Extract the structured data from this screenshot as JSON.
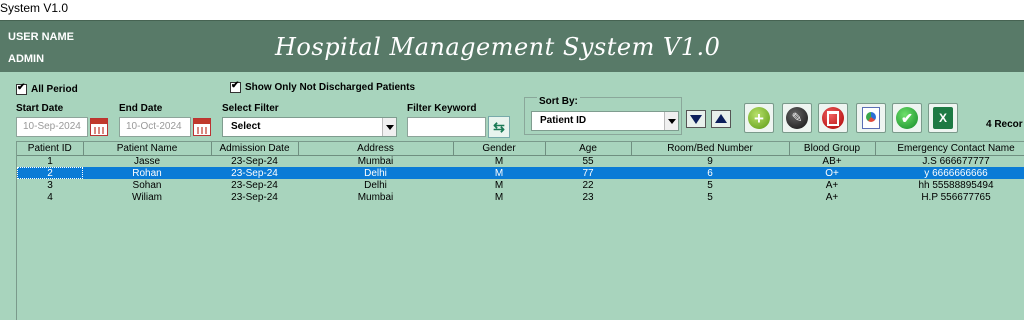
{
  "window": {
    "title": "System V1.0"
  },
  "header": {
    "user_label": "USER NAME",
    "user_value": "ADMIN",
    "app_title": "Hospital Management System V1.0",
    "bg_color": "#587a68"
  },
  "filters": {
    "all_period_label": "All Period",
    "all_period_checked": true,
    "discharged_label": "Show Only Not Discharged Patients",
    "discharged_checked": true,
    "start_date_label": "Start Date",
    "start_date_value": "10-Sep-2024",
    "end_date_label": "End Date",
    "end_date_value": "10-Oct-2024",
    "select_filter_label": "Select Filter",
    "select_filter_value": "Select",
    "keyword_label": "Filter Keyword",
    "keyword_value": ""
  },
  "sort": {
    "label": "Sort By:",
    "value": "Patient ID"
  },
  "toolbar": {
    "icons": [
      "add-icon",
      "edit-icon",
      "delete-icon",
      "report-icon",
      "confirm-icon",
      "excel-icon"
    ]
  },
  "records_count": "4 Recor",
  "table": {
    "columns": [
      "Patient ID",
      "Patient Name",
      "Admission Date",
      "Address",
      "Gender",
      "Age",
      "Room/Bed Number",
      "Blood Group",
      "Emergency Contact Name"
    ],
    "rows": [
      [
        "1",
        "Jasse",
        "23-Sep-24",
        "Mumbai",
        "M",
        "55",
        "9",
        "AB+",
        "J.S 666677777"
      ],
      [
        "2",
        "Rohan",
        "23-Sep-24",
        "Delhi",
        "M",
        "77",
        "6",
        "O+",
        "y 6666666666"
      ],
      [
        "3",
        "Sohan",
        "23-Sep-24",
        "Delhi",
        "M",
        "22",
        "5",
        "A+",
        "hh 55588895494"
      ],
      [
        "4",
        "Wiliam",
        "23-Sep-24",
        "Mumbai",
        "M",
        "23",
        "5",
        "A+",
        "H.P 556677765"
      ]
    ],
    "selected_row": 1
  },
  "colors": {
    "panel_bg": "#a8d4bd",
    "selection": "#0a7bd6"
  }
}
